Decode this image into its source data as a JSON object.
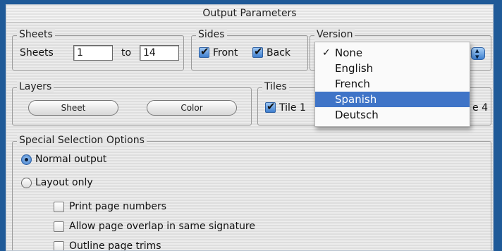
{
  "window": {
    "title": "Output Parameters"
  },
  "sheets": {
    "legend": "Sheets",
    "label": "Sheets",
    "from_value": "1",
    "to_label": "to",
    "to_value": "14"
  },
  "sides": {
    "legend": "Sides",
    "front_label": "Front",
    "front_checked": true,
    "back_label": "Back",
    "back_checked": true
  },
  "version": {
    "legend": "Version",
    "selected": "None",
    "highlighted": "Spanish",
    "options": [
      "None",
      "English",
      "French",
      "Spanish",
      "Deutsch"
    ]
  },
  "layers": {
    "legend": "Layers",
    "buttons": [
      "Sheet",
      "Color"
    ]
  },
  "tiles": {
    "legend": "Tiles",
    "tile1_label": "Tile 1",
    "tile1_checked": true,
    "clipped_label": "e 4"
  },
  "special": {
    "legend": "Special Selection Options",
    "radio_normal": "Normal output",
    "radio_layout": "Layout only",
    "selected_radio": "Normal output",
    "checkboxes": [
      "Print page numbers",
      "Allow page overlap in same signature",
      "Outline page trims"
    ]
  },
  "colors": {
    "background": "#1f5a98",
    "highlight": "#3f74c7",
    "aqua": "#3c7fd0"
  }
}
